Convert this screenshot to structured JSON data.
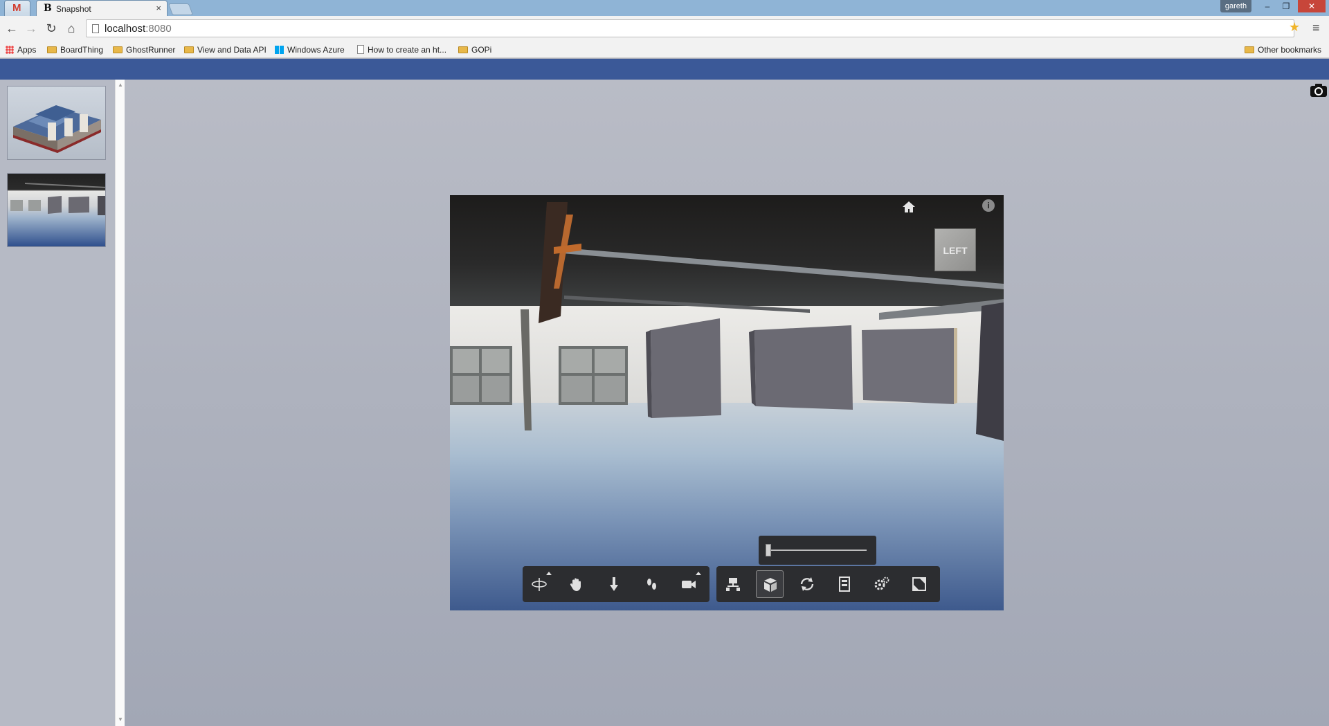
{
  "browser": {
    "tabs": [
      {
        "label": "M"
      },
      {
        "label": "Snapshot",
        "favicon": "B",
        "close": "×"
      }
    ],
    "user": "gareth",
    "window_buttons": {
      "minimize": "–",
      "restore": "❐",
      "close": "✕"
    },
    "nav": {
      "back": "←",
      "forward": "→",
      "reload": "↻",
      "home": "⌂"
    },
    "url_host": "localhost",
    "url_port": ":8080",
    "star": "★",
    "menu": "≡",
    "bookmarks": [
      {
        "label": "Apps",
        "icon": "apps-icon"
      },
      {
        "label": "BoardThing",
        "icon": "folder-icon"
      },
      {
        "label": "GhostRunner",
        "icon": "folder-icon"
      },
      {
        "label": "View and Data API",
        "icon": "folder-icon"
      },
      {
        "label": "Windows Azure",
        "icon": "windows-icon"
      },
      {
        "label": "How to create an ht...",
        "icon": "page-icon"
      },
      {
        "label": "GOPi",
        "icon": "folder-icon"
      }
    ],
    "other_bookmarks": "Other bookmarks"
  },
  "viewer": {
    "viewcube_label": "LEFT",
    "info": "i",
    "slider_value": 0,
    "nav_tools": [
      "orbit-icon",
      "pan-icon",
      "dolly-icon",
      "walk-icon",
      "camera-icon"
    ],
    "tools": [
      "model-structure-icon",
      "explode-icon",
      "rotate-icon",
      "properties-icon",
      "settings-icon",
      "fullscreen-icon"
    ],
    "active_tool": "explode-icon"
  },
  "colors": {
    "header": "#3b5998",
    "tabstrip": "#8fb4d6",
    "toolbar_bg": "#2c2d30"
  }
}
